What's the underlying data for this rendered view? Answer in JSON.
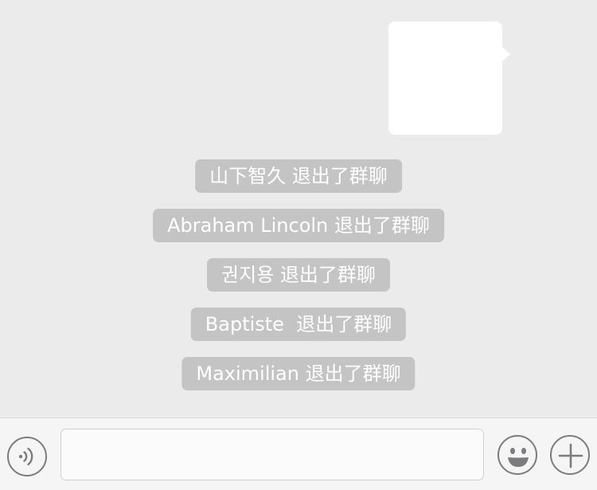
{
  "chat": {
    "notices": [
      {
        "name": "山下智久",
        "suffix": " 退出了群聊"
      },
      {
        "name": "Abraham Lincoln",
        "suffix": " 退出了群聊"
      },
      {
        "name": "권지용",
        "suffix": " 退出了群聊"
      },
      {
        "name": "Baptiste ",
        "suffix": " 退出了群聊"
      },
      {
        "name": "Maximilian",
        "suffix": " 退出了群聊"
      }
    ]
  },
  "input_bar": {
    "message_placeholder": "",
    "icons": {
      "voice": "voice-wave-icon",
      "emoji": "smiley-face-icon",
      "more": "plus-icon"
    }
  },
  "colors": {
    "background": "#ebebeb",
    "notice_pill": "#c4c4c4",
    "bubble": "#ffffff",
    "toolbar": "#f5f5f6",
    "icon_stroke": "#7c7c80"
  }
}
